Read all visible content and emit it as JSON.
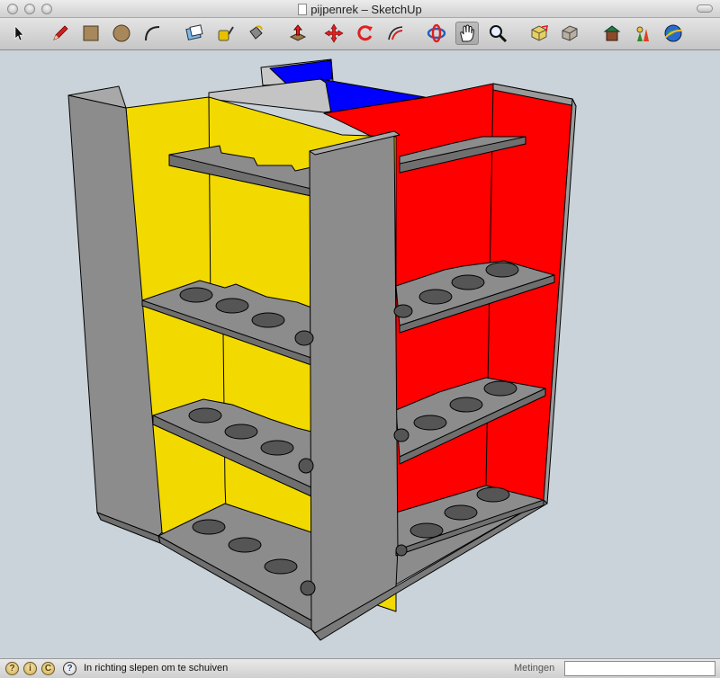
{
  "window": {
    "title": "pijpenrek – SketchUp"
  },
  "toolbar": {
    "tools": [
      {
        "name": "select-tool-icon"
      },
      {
        "name": "pencil-tool-icon"
      },
      {
        "name": "rectangle-tool-icon"
      },
      {
        "name": "circle-tool-icon"
      },
      {
        "name": "arc-tool-icon"
      },
      {
        "name": "eraser-tool-icon"
      },
      {
        "name": "tape-measure-icon"
      },
      {
        "name": "paint-bucket-icon"
      },
      {
        "name": "push-pull-icon"
      },
      {
        "name": "move-tool-icon"
      },
      {
        "name": "rotate-tool-icon"
      },
      {
        "name": "offset-tool-icon"
      },
      {
        "name": "orbit-tool-icon"
      },
      {
        "name": "pan-hand-icon",
        "active": true
      },
      {
        "name": "zoom-magnifier-icon"
      },
      {
        "name": "zoom-extents-icon"
      },
      {
        "name": "previous-view-icon"
      },
      {
        "name": "warehouse-icon"
      },
      {
        "name": "components-icon"
      },
      {
        "name": "google-earth-icon"
      }
    ]
  },
  "statusbar": {
    "message": "In richting slepen om te schuiven",
    "measurements_label": "Metingen",
    "measurements_value": ""
  },
  "colors": {
    "yellow_panel": "#f2d900",
    "red_panel": "#ff0000",
    "blue_panel": "#0000ff",
    "gray_panel": "#8c8c8c",
    "light_gray": "#c4c4c4",
    "background": "#c9d3d9"
  }
}
